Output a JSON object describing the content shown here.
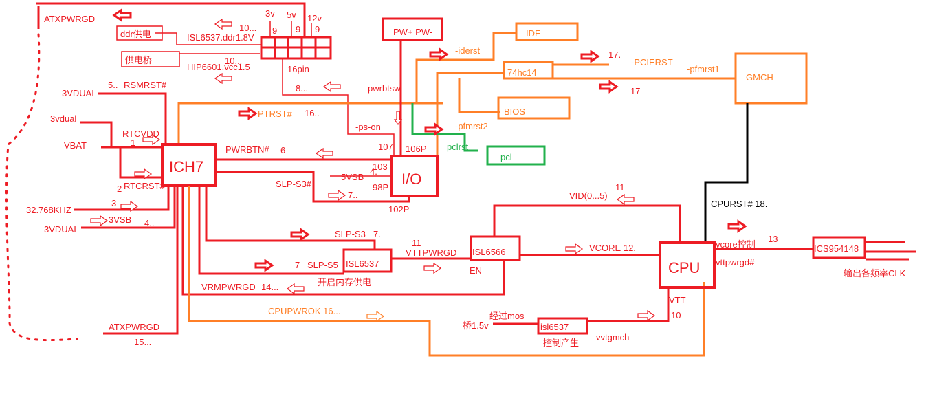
{
  "colors": {
    "red": "#ed1c24",
    "orange": "#ff7f27",
    "green": "#22b14c",
    "black": "#000000"
  },
  "blocks": {
    "ich7": "ICH7",
    "io": "I/O",
    "cpu": "CPU",
    "gmch": "GMCH",
    "ide": "IDE",
    "bios": "BIOS",
    "pcl": "pcl",
    "hc14": "74hc14",
    "pw": "PW+  PW-",
    "isl6566": "ISL6566",
    "isl6537_mem": "ISL6537",
    "isl6537_vtt": "isl6537",
    "ics": "ICS954148",
    "ddr": "ddr供电",
    "bridge": "供电桥"
  },
  "labels": {
    "atxpwrgd_top": "ATXPWRGD",
    "v3": "3v",
    "v5": "5v",
    "v12": "12v",
    "n9a": "9",
    "n9b": "9",
    "n9c": "9",
    "ten_a": "10...",
    "isl_ddr": "ISL6537.ddr1.8V",
    "ten_b": "10...",
    "hip": "HIP6601.vcc1.5",
    "pin16": "16pin",
    "eight": "8...",
    "rsm_num": "5..",
    "rsmrst": "RSMRST#",
    "vdual1": "3VDUAL",
    "vdual2": "3vdual",
    "rtcvdd": "RTCVDD",
    "one": "1",
    "vbat": "VBAT",
    "two": "2",
    "rtcrst": "RTCRST#",
    "three": "3",
    "khz": "32.768KHZ",
    "vsb3": "3VSB",
    "four": "4..",
    "vdual3": "3VDUAL",
    "atxpwrgd_bot": "ATXPWRGD",
    "fifteen": "15...",
    "ptrst": "PTRST#",
    "sixteen": "16..",
    "pwrbtn": "PWRBTN#",
    "six": "6",
    "slps3n": "SLP-S3#",
    "seven_a": "7..",
    "vsb5": "5VSB",
    "four_b": "4.",
    "p103": "103",
    "p98": "98P",
    "p102": "102P",
    "p107": "107",
    "p106": "106P",
    "pwrbtsw": "pwrbtsw",
    "pson": "-ps-on",
    "iderst": "-iderst",
    "seventeen_a": "17.",
    "pcierst": "-PCIERST",
    "pfmrst1": "-pfmrst1",
    "seventeen_b": "17",
    "pfmrst2": "-pfmrst2",
    "pclrst": "pclrst",
    "slps3": "SLP-S3",
    "seven_b": "7.",
    "seven_c": "7",
    "slps5": "SLP-S5",
    "mem_on": "开启内存供电",
    "eleven_a": "11",
    "vttpwrgd": "VTTPWRGD",
    "en": "EN",
    "vrmpwrgd": "VRMPWRGD",
    "fourteen": "14...",
    "cpupwrok": "CPUPWROK  16...",
    "vid": "VID(0...5)",
    "eleven_b": "11",
    "vcore": "VCORE  12.",
    "cpurst": "CPURST#  18.",
    "vcore_ctl": "vcore控制",
    "thirteen": "13",
    "vttpwrgd_n": "vttpwrgd#",
    "clk_out": "输出各频率CLK",
    "vtt": "VTT",
    "ten_c": "10",
    "via_mos": "经过mos",
    "bridge15": "桥1.5v",
    "ctl_gen": "控制产生",
    "vvtgmch": "vvtgmch"
  }
}
